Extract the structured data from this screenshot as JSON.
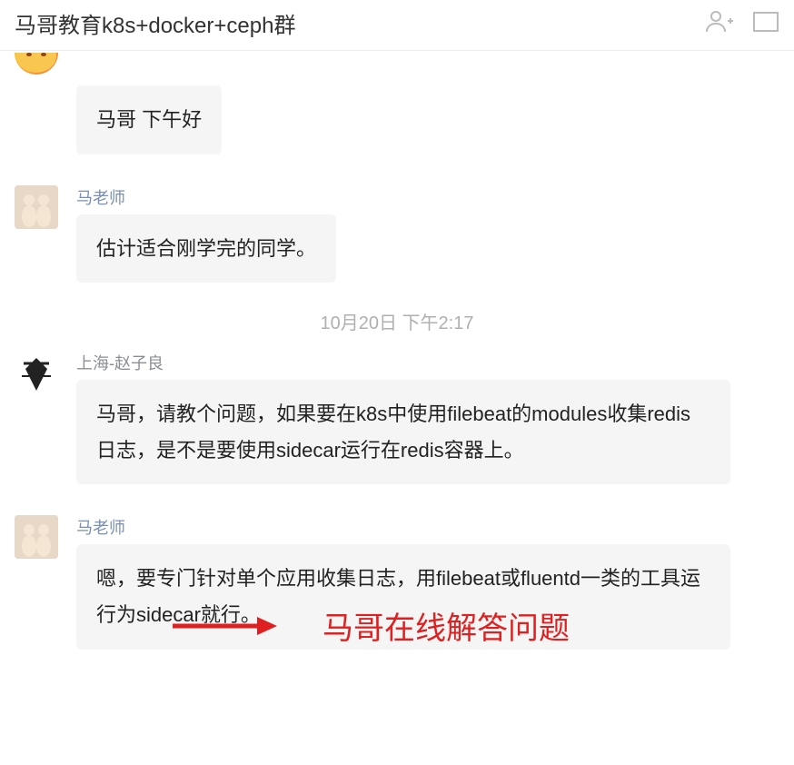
{
  "header": {
    "title": "马哥教育k8s+docker+ceph群"
  },
  "timestamp": "10月20日  下午2:17",
  "messages": [
    {
      "nickname": "",
      "text": "马哥 下午好",
      "avatar_kind": "emoji"
    },
    {
      "nickname": "马老师",
      "text": "估计适合刚学完的同学。",
      "avatar_kind": "two"
    },
    {
      "nickname": "上海-赵子良",
      "text": "马哥，请教个问题，如果要在k8s中使用filebeat的modules收集redis日志，是不是要使用sidecar运行在redis容器上。",
      "avatar_kind": "ninja"
    },
    {
      "nickname": "马老师",
      "text": "嗯，要专门针对单个应用收集日志，用filebeat或fluentd一类的工具运行为sidecar就行。",
      "avatar_kind": "two"
    }
  ],
  "annotation": "马哥在线解答问题"
}
